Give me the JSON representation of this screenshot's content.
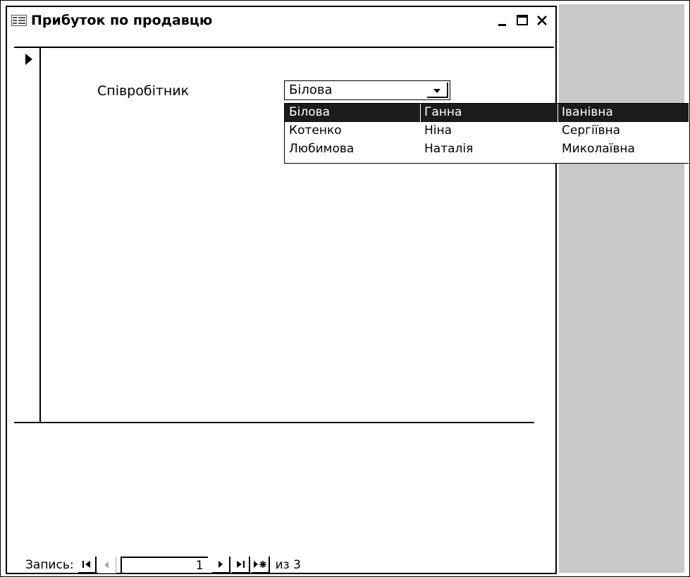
{
  "window": {
    "title": "Прибуток по продавцю",
    "controls": {
      "minimize": "_",
      "maximize": "□",
      "close": "×"
    }
  },
  "form": {
    "employee_label": "Співробітник",
    "combo": {
      "value": "Білова"
    }
  },
  "dropdown": {
    "rows": [
      {
        "last": "Білова",
        "first": "Ганна",
        "middle": "Іванівна",
        "selected": true
      },
      {
        "last": "Котенко",
        "first": "Ніна",
        "middle": "Сергіївна",
        "selected": false
      },
      {
        "last": "Любимова",
        "first": "Наталія",
        "middle": "Миколаївна",
        "selected": false
      }
    ]
  },
  "navigation": {
    "label": "Запись:",
    "current": "1",
    "total_text": "из 3",
    "buttons": {
      "first": "I◀",
      "prev": "◀",
      "next": "▶",
      "last": "▶I",
      "new": "▶*"
    }
  },
  "colors": {
    "selected_row": "#1b1b1b",
    "side_area": "#c8c8c8"
  }
}
